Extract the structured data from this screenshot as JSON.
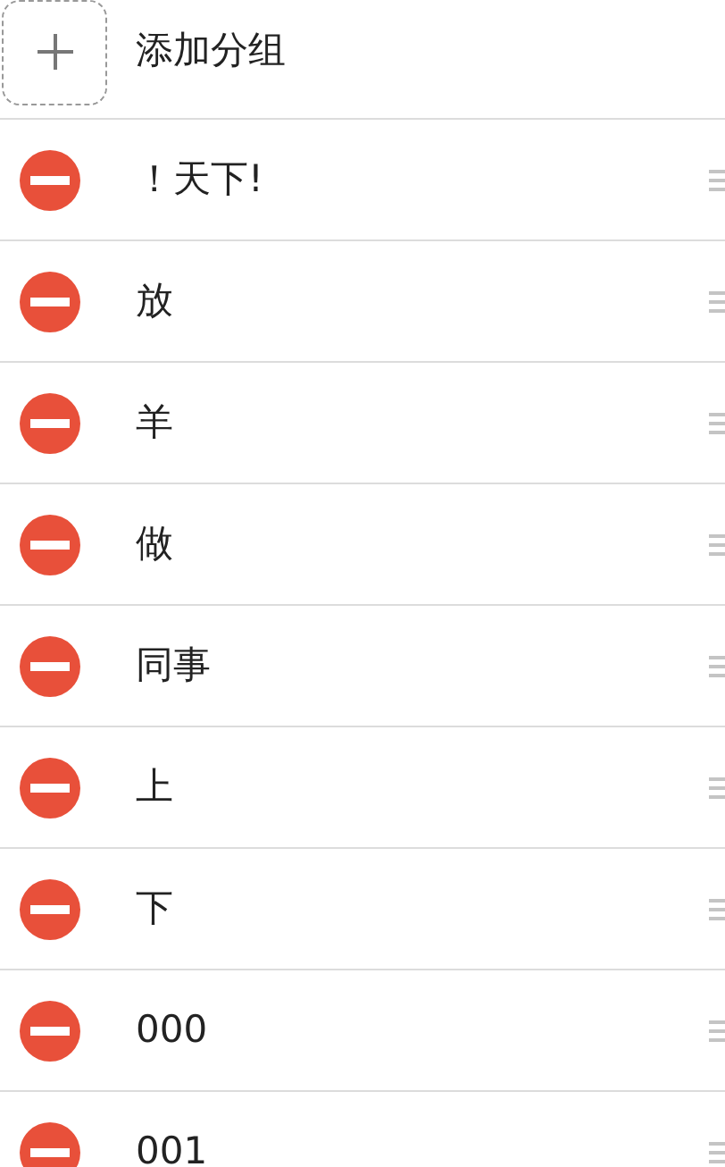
{
  "add_group": {
    "label": "添加分组"
  },
  "groups": [
    {
      "name": "！天下!"
    },
    {
      "name": "放"
    },
    {
      "name": "羊"
    },
    {
      "name": "做"
    },
    {
      "name": "同事"
    },
    {
      "name": "上"
    },
    {
      "name": "下"
    },
    {
      "name": "000"
    },
    {
      "name": "001"
    }
  ]
}
